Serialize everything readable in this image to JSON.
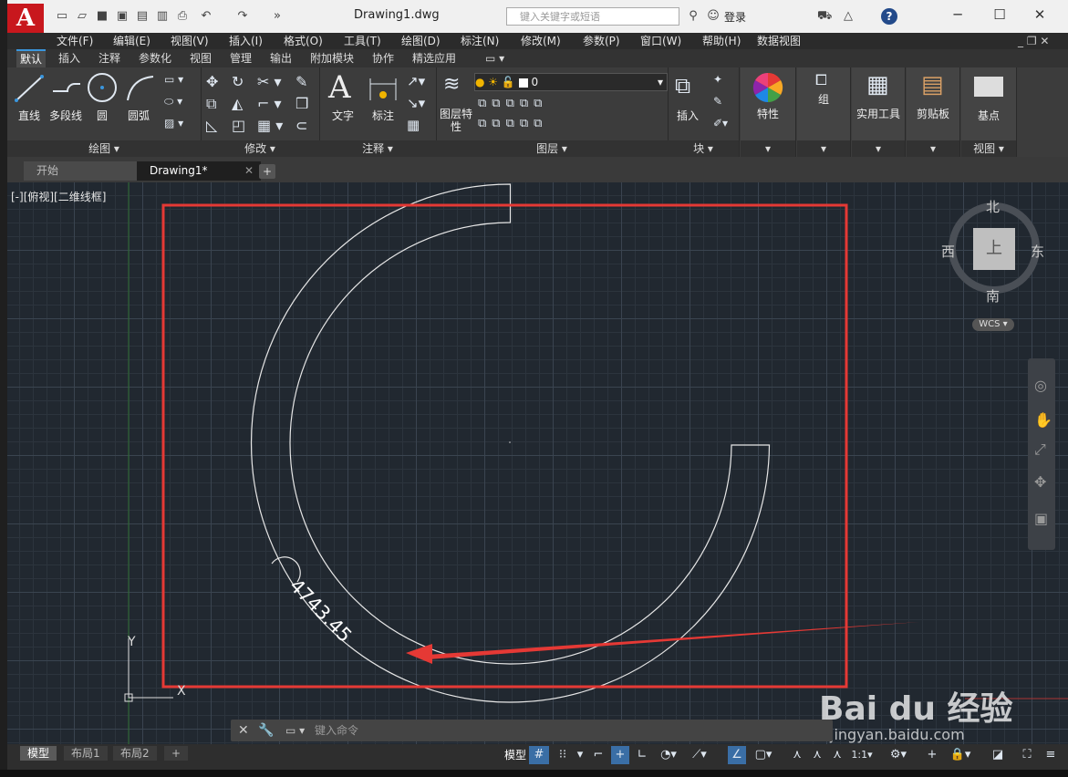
{
  "title_bar": {
    "logo": "A",
    "document_title": "Drawing1.dwg",
    "search_placeholder": "键入关键字或短语",
    "login_label": "登录",
    "help_label": "?"
  },
  "menu_bar": {
    "items": [
      "文件(F)",
      "编辑(E)",
      "视图(V)",
      "插入(I)",
      "格式(O)",
      "工具(T)",
      "绘图(D)",
      "标注(N)",
      "修改(M)",
      "参数(P)",
      "窗口(W)",
      "帮助(H)",
      "数据视图"
    ]
  },
  "ribbon_tabs": [
    "默认",
    "插入",
    "注释",
    "参数化",
    "视图",
    "管理",
    "输出",
    "附加模块",
    "协作",
    "精选应用"
  ],
  "ribbon": {
    "draw_panel": {
      "label": "绘图",
      "tools": [
        "直线",
        "多段线",
        "圆",
        "圆弧"
      ]
    },
    "modify_panel": {
      "label": "修改"
    },
    "annotation_panel": {
      "label": "注释",
      "tools": [
        "文字",
        "标注"
      ]
    },
    "layers_panel": {
      "label": "图层",
      "tools": [
        "图层特性"
      ],
      "current_layer": "0"
    },
    "block_panel": {
      "label": "块",
      "tools": [
        "插入"
      ]
    },
    "properties_panel": {
      "label": "特性"
    },
    "group_panel": {
      "label": "组"
    },
    "utilities_panel": {
      "label": "实用工具"
    },
    "clipboard_panel": {
      "label": "剪贴板"
    },
    "view_panel": {
      "label": "视图",
      "tools": [
        "基点"
      ]
    }
  },
  "file_tabs": [
    "开始",
    "Drawing1*"
  ],
  "viewport": {
    "label": "[-][俯视][二维线框]",
    "dimension_text": "4743.45",
    "ucs_x": "X",
    "ucs_y": "Y"
  },
  "view_cube": {
    "north": "北",
    "south": "南",
    "east": "东",
    "west": "西",
    "top": "上",
    "wcs": "WCS"
  },
  "command_line": {
    "placeholder": "键入命令"
  },
  "layout_tabs": [
    "模型",
    "布局1",
    "布局2"
  ],
  "status_bar": {
    "model_label": "模型",
    "scale": "1:1"
  },
  "watermark": {
    "brand": "Bai du 经验",
    "url": "jingyan.baidu.com"
  },
  "colors": {
    "annotation_red": "#e53935",
    "accent_blue": "#3a96dd",
    "canvas_bg": "#212830"
  }
}
